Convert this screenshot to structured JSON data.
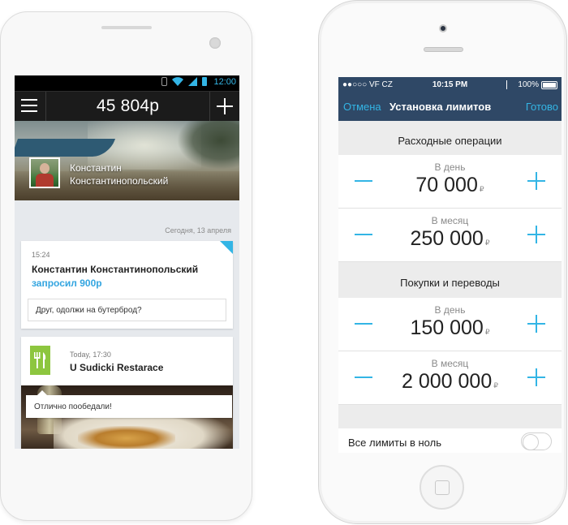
{
  "android": {
    "status": {
      "time": "12:00"
    },
    "action_bar": {
      "balance": "45 804р"
    },
    "profile": {
      "first_name": "Константин",
      "last_name": "Константинопольский"
    },
    "date_header": "Сегодня, 13 апреля",
    "request_card": {
      "time": "15:24",
      "sender": "Константин Константинопольский",
      "action": "запросил 900р",
      "message": "Друг, одолжи на бутерброд?"
    },
    "place_card": {
      "when": "Today, 17:30",
      "place": "U Sudicki Restarace",
      "comment": "Отлично пообедали!"
    }
  },
  "ios": {
    "status": {
      "carrier": "●●○○○ VF CZ",
      "time": "10:15 PM",
      "battery": "100%"
    },
    "nav": {
      "cancel": "Отмена",
      "title": "Установка лимитов",
      "done": "Готово"
    },
    "sections": [
      {
        "title": "Расходные операции",
        "rows": [
          {
            "period": "В день",
            "amount": "70 000",
            "currency": "₽"
          },
          {
            "period": "В месяц",
            "amount": "250 000",
            "currency": "₽"
          }
        ]
      },
      {
        "title": "Покупки и переводы",
        "rows": [
          {
            "period": "В день",
            "amount": "150 000",
            "currency": "₽"
          },
          {
            "period": "В месяц",
            "amount": "2 000 000",
            "currency": "₽"
          }
        ]
      }
    ],
    "zero_limits": {
      "label": "Все лимиты в ноль",
      "enabled": false
    }
  },
  "colors": {
    "accent": "#33b5e5",
    "ios_bar": "#2f4866",
    "food_green": "#8dc63f"
  }
}
